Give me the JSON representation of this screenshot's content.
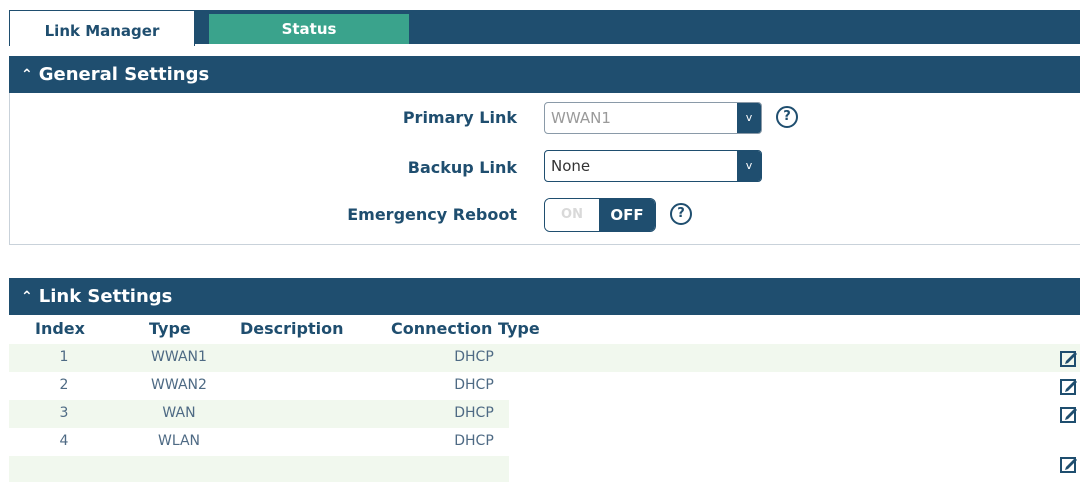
{
  "tabs": [
    {
      "label": "Link Manager"
    },
    {
      "label": "Status"
    }
  ],
  "general": {
    "title": "General Settings",
    "primary_link": {
      "label": "Primary Link",
      "value": "WWAN1"
    },
    "backup_link": {
      "label": "Backup Link",
      "value": "None"
    },
    "emergency_reboot": {
      "label": "Emergency Reboot",
      "on_label": "ON",
      "off_label": "OFF"
    }
  },
  "link_settings": {
    "title": "Link Settings",
    "columns": [
      "Index",
      "Type",
      "Description",
      "Connection Type"
    ],
    "rows": [
      {
        "index": "1",
        "type": "WWAN1",
        "description": "",
        "connection": "DHCP"
      },
      {
        "index": "2",
        "type": "WWAN2",
        "description": "",
        "connection": "DHCP"
      },
      {
        "index": "3",
        "type": "WAN",
        "description": "",
        "connection": "DHCP"
      },
      {
        "index": "4",
        "type": "WLAN",
        "description": "",
        "connection": "DHCP"
      }
    ]
  },
  "icons": {
    "caret": "chevron-down-icon",
    "collapse": "chevron-up-icon",
    "help": "question-circle-icon",
    "edit": "edit-icon"
  },
  "colors": {
    "primary": "#1f4e6f",
    "accent": "#3aa38c",
    "row_alt": "#f1f8ee"
  }
}
